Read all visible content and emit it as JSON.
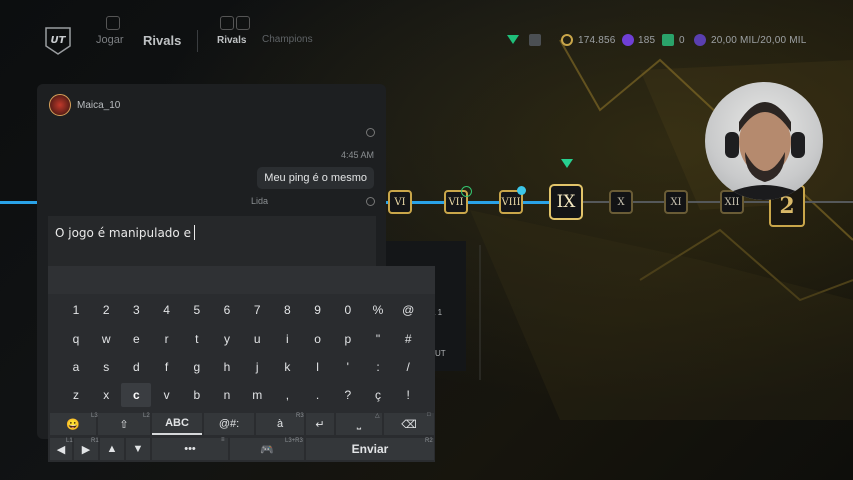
{
  "topbar": {
    "logo": "UT",
    "nav": {
      "play": "Jogar",
      "rivals": "Rivals",
      "rivals_tab": "Rivals",
      "champions_tab": "Champions"
    },
    "stats": {
      "coins": "174.856",
      "fc_points": "185",
      "tokens": "0",
      "capacity": "20,00 MIL/20,00 MIL"
    }
  },
  "progress": {
    "nodes": [
      "VI",
      "VII",
      "VIII",
      "IX",
      "X",
      "XI",
      "XII"
    ],
    "current": "IX",
    "rank_badge": "2"
  },
  "chat": {
    "username": "Maica_10",
    "time": "4:45 AM",
    "message": "Meu ping é o mesmo",
    "status": "Lida",
    "input_value": "O jogo é manipulado e"
  },
  "side_panel": {
    "line1": "a",
    "line2": "a 1",
    "line3": "UT"
  },
  "keyboard": {
    "row1": [
      "1",
      "2",
      "3",
      "4",
      "5",
      "6",
      "7",
      "8",
      "9",
      "0",
      "%",
      "@"
    ],
    "row2": [
      "q",
      "w",
      "e",
      "r",
      "t",
      "y",
      "u",
      "i",
      "o",
      "p",
      "\"",
      "#"
    ],
    "row3": [
      "a",
      "s",
      "d",
      "f",
      "g",
      "h",
      "j",
      "k",
      "l",
      "'",
      ":",
      "/"
    ],
    "row4": [
      "z",
      "x",
      "c",
      "v",
      "b",
      "n",
      "m",
      ",",
      ".",
      "?",
      "ç",
      "!"
    ],
    "selected": "c",
    "func": {
      "emoji": "😀",
      "shift": "⇧",
      "abc": "ABC",
      "symbols": "@#:",
      "accent": "à",
      "enter": "↵",
      "space": "⎵",
      "backspace": "⌫"
    },
    "nav": {
      "left": "◀",
      "right": "▶",
      "up": "▲",
      "down": "▼",
      "more": "•••",
      "gamepad": "🎮",
      "send": "Enviar"
    },
    "hints": {
      "l3": "L3",
      "l2": "L2",
      "r3": "R3",
      "triangle": "△",
      "square": "□",
      "l1": "L1",
      "r1": "R1",
      "options": "≡",
      "l3r3": "L3+R3",
      "r2": "R2"
    }
  }
}
